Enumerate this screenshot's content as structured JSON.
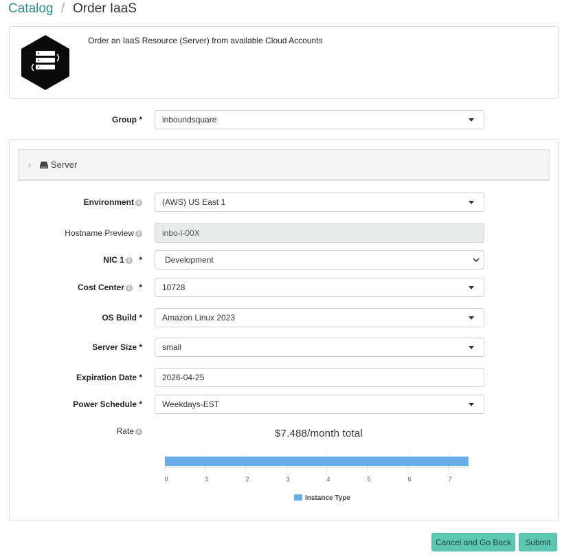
{
  "breadcrumb": {
    "catalog": "Catalog",
    "separator": "/",
    "current": "Order IaaS"
  },
  "description": "Order an IaaS Resource (Server) from available Cloud Accounts",
  "group": {
    "label": "Group *",
    "value": "inboundsquare"
  },
  "accordion": {
    "label": "Server"
  },
  "fields": {
    "environment": {
      "label": "Environment",
      "value": "(AWS) US East 1"
    },
    "hostname": {
      "label": "Hostname Preview",
      "value": "inbo-l-00X"
    },
    "nic1": {
      "label": "NIC 1",
      "required": "*",
      "value": "Development"
    },
    "cost_center": {
      "label": "Cost Center",
      "required": "*",
      "value": "10728"
    },
    "os_build": {
      "label": "OS Build *",
      "value": "Amazon Linux 2023"
    },
    "server_size": {
      "label": "Server Size *",
      "value": "small"
    },
    "expiration": {
      "label": "Expiration Date *",
      "value": "2026-04-25"
    },
    "power_schedule": {
      "label": "Power Schedule *",
      "value": "Weekdays-EST"
    },
    "rate": {
      "label": "Rate"
    }
  },
  "chart_data": {
    "type": "bar",
    "orientation": "horizontal",
    "title": "$7.488/month total",
    "series": [
      {
        "name": "Instance Type",
        "values": [
          7.488
        ],
        "color": "#6aaee8"
      }
    ],
    "xlim": [
      0,
      7.488
    ],
    "x_ticks": [
      "0",
      "1",
      "2",
      "3",
      "4",
      "5",
      "6",
      "7"
    ],
    "grid": true,
    "legend": "bottom"
  },
  "buttons": {
    "cancel": "Cancel and Go Back",
    "submit": "Submit"
  },
  "colors": {
    "accent": "#2a8c87",
    "button": "#5cc8b2",
    "bar": "#6aaee8"
  }
}
